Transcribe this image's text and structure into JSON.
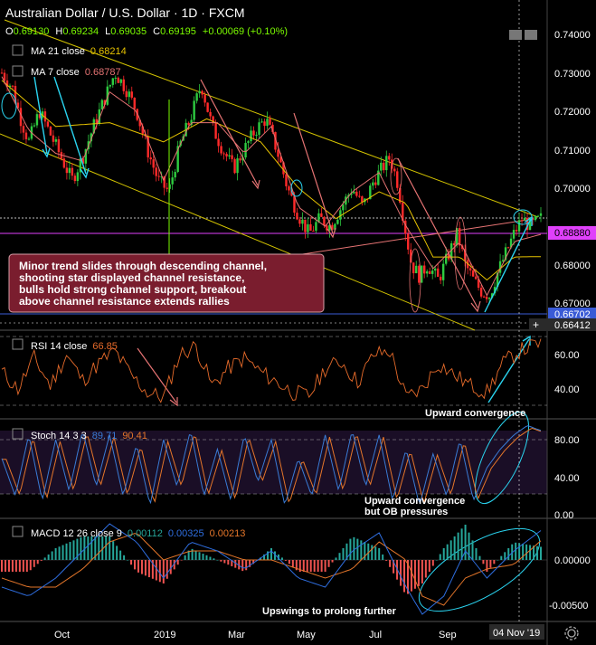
{
  "header": {
    "title": "Australian Dollar / U.S. Dollar · 1D · FXCM",
    "ohlc": {
      "o_label": "O",
      "o": "0.69130",
      "h_label": "H",
      "h": "0.69234",
      "l_label": "L",
      "l": "0.69035",
      "c_label": "C",
      "c": "0.69195",
      "change": "+0.00069 (+0.10%)"
    },
    "ma21": {
      "label": "MA  21 close",
      "value": "0.68214"
    },
    "ma7": {
      "label": "MA  7 close",
      "value": "0.68787"
    }
  },
  "price_axis": {
    "ticks": [
      "0.74000",
      "0.73000",
      "0.72000",
      "0.71000",
      "0.70000",
      "0.68000",
      "0.67000"
    ],
    "badges": {
      "pink": "0.68880",
      "blue": "0.66702",
      "cursor": "0.66412"
    }
  },
  "annotations": {
    "main_box": [
      "Minor trend slides through descending channel,",
      "shooting star displayed channel resistance,",
      "bulls hold strong channel support, breakout",
      "above channel resistance extends rallies"
    ],
    "rsi_note": "Upward convergence",
    "stoch_note": [
      "Upward convergence",
      "but OB pressures"
    ],
    "macd_note": "Upswings to prolong further"
  },
  "rsi": {
    "label": "RSI  14 close",
    "value": "66.85",
    "ticks": [
      "60.00",
      "40.00"
    ]
  },
  "stoch": {
    "label": "Stoch  14 3 3",
    "k": "89.71",
    "d": "90.41",
    "ticks": [
      "80.00",
      "40.00",
      "0.00"
    ]
  },
  "macd": {
    "label": "MACD  12 26 close 9",
    "hist": "0.00112",
    "macd": "0.00325",
    "signal": "0.00213",
    "ticks": [
      "0.00000",
      "-0.00500"
    ]
  },
  "time_axis": {
    "labels": [
      "Oct",
      "2019",
      "Mar",
      "May",
      "Jul",
      "Sep"
    ],
    "cursor_date": "04 Nov '19"
  },
  "colors": {
    "up": "#26a69a",
    "down": "#ef5350",
    "green_candle": "#2ecc40",
    "red_candle": "#ff2a2a",
    "ma21": "#e6c200",
    "ma7": "#e57373",
    "channel": "#d4c400",
    "rsi": "#e56a2a",
    "stoch_k": "#3a7bd5",
    "stoch_d": "#e5762a",
    "macd": "#2f6ee0",
    "signal": "#e5762a",
    "cyan": "#2ad4f0",
    "box_bg": "#7a1d2e",
    "pink_line": "#e040fb",
    "blue_line": "#3a5bd6"
  },
  "chart_data": {
    "type": "candlestick",
    "symbol": "AUDUSD",
    "timeframe": "1D",
    "ylim": [
      0.665,
      0.742
    ],
    "price_path": [
      [
        0,
        0.73
      ],
      [
        0.02,
        0.726
      ],
      [
        0.035,
        0.718
      ],
      [
        0.05,
        0.712
      ],
      [
        0.07,
        0.72
      ],
      [
        0.09,
        0.714
      ],
      [
        0.11,
        0.708
      ],
      [
        0.13,
        0.702
      ],
      [
        0.15,
        0.708
      ],
      [
        0.17,
        0.716
      ],
      [
        0.19,
        0.723
      ],
      [
        0.21,
        0.73
      ],
      [
        0.23,
        0.726
      ],
      [
        0.25,
        0.72
      ],
      [
        0.27,
        0.71
      ],
      [
        0.29,
        0.702
      ],
      [
        0.31,
        0.699
      ],
      [
        0.33,
        0.711
      ],
      [
        0.35,
        0.718
      ],
      [
        0.37,
        0.727
      ],
      [
        0.39,
        0.716
      ],
      [
        0.41,
        0.71
      ],
      [
        0.43,
        0.705
      ],
      [
        0.45,
        0.71
      ],
      [
        0.47,
        0.715
      ],
      [
        0.49,
        0.718
      ],
      [
        0.51,
        0.71
      ],
      [
        0.53,
        0.7
      ],
      [
        0.55,
        0.693
      ],
      [
        0.57,
        0.688
      ],
      [
        0.59,
        0.692
      ],
      [
        0.61,
        0.69
      ],
      [
        0.63,
        0.695
      ],
      [
        0.65,
        0.7
      ],
      [
        0.67,
        0.695
      ],
      [
        0.69,
        0.702
      ],
      [
        0.71,
        0.706
      ],
      [
        0.72,
        0.708
      ],
      [
        0.735,
        0.701
      ],
      [
        0.75,
        0.688
      ],
      [
        0.76,
        0.68
      ],
      [
        0.775,
        0.677
      ],
      [
        0.79,
        0.68
      ],
      [
        0.81,
        0.676
      ],
      [
        0.83,
        0.683
      ],
      [
        0.845,
        0.688
      ],
      [
        0.86,
        0.68
      ],
      [
        0.875,
        0.676
      ],
      [
        0.89,
        0.673
      ],
      [
        0.905,
        0.672
      ],
      [
        0.92,
        0.678
      ],
      [
        0.935,
        0.683
      ],
      [
        0.95,
        0.688
      ],
      [
        0.965,
        0.692
      ],
      [
        0.98,
        0.69
      ],
      [
        1.0,
        0.692
      ]
    ],
    "ma21_path": [
      [
        0,
        0.728
      ],
      [
        0.1,
        0.716
      ],
      [
        0.2,
        0.717
      ],
      [
        0.3,
        0.712
      ],
      [
        0.38,
        0.718
      ],
      [
        0.48,
        0.712
      ],
      [
        0.55,
        0.7
      ],
      [
        0.62,
        0.692
      ],
      [
        0.7,
        0.699
      ],
      [
        0.75,
        0.696
      ],
      [
        0.8,
        0.682
      ],
      [
        0.85,
        0.682
      ],
      [
        0.9,
        0.676
      ],
      [
        0.95,
        0.682
      ],
      [
        1.0,
        0.6821
      ]
    ],
    "ma7_path": [
      [
        0,
        0.729
      ],
      [
        0.05,
        0.715
      ],
      [
        0.1,
        0.709
      ],
      [
        0.15,
        0.707
      ],
      [
        0.2,
        0.725
      ],
      [
        0.25,
        0.72
      ],
      [
        0.3,
        0.702
      ],
      [
        0.35,
        0.717
      ],
      [
        0.4,
        0.717
      ],
      [
        0.45,
        0.709
      ],
      [
        0.5,
        0.716
      ],
      [
        0.55,
        0.695
      ],
      [
        0.6,
        0.69
      ],
      [
        0.65,
        0.699
      ],
      [
        0.7,
        0.704
      ],
      [
        0.75,
        0.69
      ],
      [
        0.8,
        0.679
      ],
      [
        0.85,
        0.686
      ],
      [
        0.9,
        0.672
      ],
      [
        0.95,
        0.686
      ],
      [
        1.0,
        0.6879
      ]
    ],
    "rsi_series": [
      [
        0,
        50
      ],
      [
        0.03,
        40
      ],
      [
        0.06,
        58
      ],
      [
        0.09,
        42
      ],
      [
        0.12,
        60
      ],
      [
        0.15,
        45
      ],
      [
        0.18,
        55
      ],
      [
        0.21,
        62
      ],
      [
        0.24,
        48
      ],
      [
        0.27,
        38
      ],
      [
        0.3,
        35
      ],
      [
        0.33,
        60
      ],
      [
        0.36,
        65
      ],
      [
        0.39,
        42
      ],
      [
        0.42,
        52
      ],
      [
        0.45,
        58
      ],
      [
        0.48,
        50
      ],
      [
        0.51,
        44
      ],
      [
        0.54,
        38
      ],
      [
        0.57,
        36
      ],
      [
        0.6,
        52
      ],
      [
        0.63,
        56
      ],
      [
        0.66,
        44
      ],
      [
        0.69,
        60
      ],
      [
        0.72,
        62
      ],
      [
        0.75,
        35
      ],
      [
        0.78,
        40
      ],
      [
        0.81,
        55
      ],
      [
        0.84,
        48
      ],
      [
        0.87,
        42
      ],
      [
        0.9,
        38
      ],
      [
        0.93,
        55
      ],
      [
        0.96,
        62
      ],
      [
        1.0,
        66.85
      ]
    ],
    "stoch_k": [
      [
        0,
        60
      ],
      [
        0.025,
        20
      ],
      [
        0.05,
        85
      ],
      [
        0.075,
        15
      ],
      [
        0.1,
        80
      ],
      [
        0.125,
        25
      ],
      [
        0.15,
        90
      ],
      [
        0.175,
        30
      ],
      [
        0.2,
        85
      ],
      [
        0.225,
        20
      ],
      [
        0.25,
        75
      ],
      [
        0.275,
        10
      ],
      [
        0.3,
        80
      ],
      [
        0.325,
        30
      ],
      [
        0.35,
        90
      ],
      [
        0.375,
        20
      ],
      [
        0.4,
        70
      ],
      [
        0.425,
        15
      ],
      [
        0.45,
        85
      ],
      [
        0.475,
        35
      ],
      [
        0.5,
        80
      ],
      [
        0.525,
        10
      ],
      [
        0.55,
        60
      ],
      [
        0.575,
        20
      ],
      [
        0.6,
        85
      ],
      [
        0.625,
        25
      ],
      [
        0.65,
        90
      ],
      [
        0.675,
        30
      ],
      [
        0.7,
        85
      ],
      [
        0.725,
        15
      ],
      [
        0.75,
        70
      ],
      [
        0.775,
        10
      ],
      [
        0.8,
        65
      ],
      [
        0.825,
        20
      ],
      [
        0.85,
        80
      ],
      [
        0.875,
        15
      ],
      [
        0.9,
        50
      ],
      [
        0.925,
        70
      ],
      [
        0.95,
        85
      ],
      [
        0.975,
        95
      ],
      [
        1.0,
        89.71
      ]
    ],
    "macd_line": [
      [
        0,
        -0.003
      ],
      [
        0.05,
        -0.004
      ],
      [
        0.1,
        -0.002
      ],
      [
        0.15,
        0.001
      ],
      [
        0.2,
        0.004
      ],
      [
        0.25,
        0.002
      ],
      [
        0.3,
        -0.002
      ],
      [
        0.35,
        0.002
      ],
      [
        0.4,
        0.001
      ],
      [
        0.45,
        -0.001
      ],
      [
        0.5,
        0.001
      ],
      [
        0.55,
        -0.002
      ],
      [
        0.6,
        -0.003
      ],
      [
        0.65,
        0.001
      ],
      [
        0.7,
        0.003
      ],
      [
        0.75,
        -0.003
      ],
      [
        0.78,
        -0.006
      ],
      [
        0.82,
        -0.004
      ],
      [
        0.86,
        0.001
      ],
      [
        0.9,
        -0.002
      ],
      [
        0.95,
        0.001
      ],
      [
        1.0,
        0.00325
      ]
    ],
    "signal_line": [
      [
        0,
        -0.002
      ],
      [
        0.05,
        -0.003
      ],
      [
        0.1,
        -0.003
      ],
      [
        0.15,
        -0.001
      ],
      [
        0.2,
        0.002
      ],
      [
        0.25,
        0.003
      ],
      [
        0.3,
        0.0
      ],
      [
        0.35,
        0.001
      ],
      [
        0.4,
        0.001
      ],
      [
        0.45,
        0.0
      ],
      [
        0.5,
        0.0
      ],
      [
        0.55,
        -0.001
      ],
      [
        0.6,
        -0.002
      ],
      [
        0.65,
        -0.001
      ],
      [
        0.7,
        0.002
      ],
      [
        0.75,
        0.0
      ],
      [
        0.78,
        -0.004
      ],
      [
        0.82,
        -0.005
      ],
      [
        0.86,
        -0.002
      ],
      [
        0.9,
        -0.001
      ],
      [
        0.95,
        -0.0005
      ],
      [
        1.0,
        0.00213
      ]
    ]
  }
}
